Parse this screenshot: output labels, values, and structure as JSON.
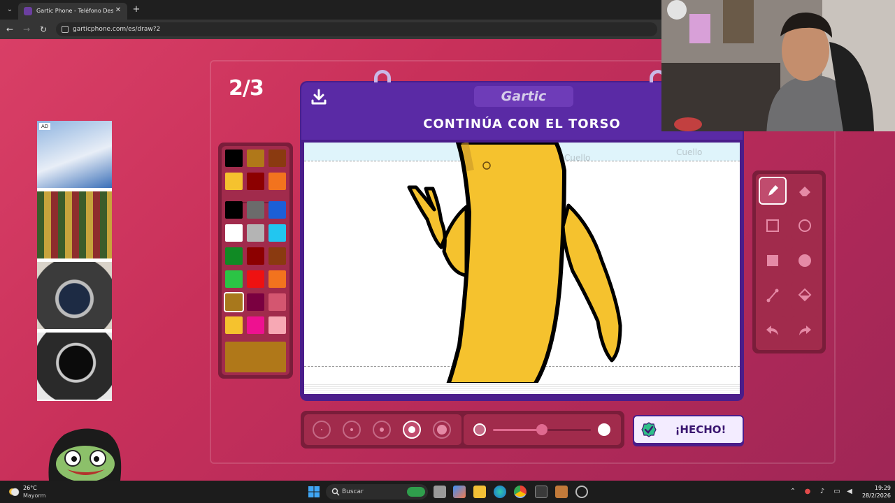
{
  "browser": {
    "tab_title": "Gartic Phone - Teléfono Descon",
    "url": "garticphone.com/es/draw?2"
  },
  "game": {
    "round": "2/3",
    "logo": "Gartic",
    "prompt": "CONTINÚA CON EL TORSO",
    "done_label": "¡HECHO!",
    "canvas_notes": [
      "Cuello",
      "Cuello"
    ]
  },
  "palette": {
    "colors": [
      "#000000",
      "#b07819",
      "#8a3a10",
      "#f5c22e",
      "#8c0000",
      "#f2731e",
      "#000000",
      "#6b6b6b",
      "#1b5fd6",
      "#ffffff",
      "#b4b4b4",
      "#22c6f0",
      "#108a24",
      "#8c0000",
      "#8a3a10",
      "#2bc445",
      "#ee1111",
      "#f2731e",
      "#a8781c",
      "#7a0040",
      "#d45670",
      "#f5c22e",
      "#ee1190",
      "#f7a8b4"
    ],
    "selected_index": 18,
    "current_color": "#b07819"
  },
  "tools": [
    "pen-icon",
    "eraser-icon",
    "rectangle-outline-icon",
    "circle-outline-icon",
    "rectangle-fill-icon",
    "circle-fill-icon",
    "line-icon",
    "fill-bucket-icon",
    "undo-icon",
    "redo-icon"
  ],
  "brush": {
    "sizes_selected_index": 3,
    "opacity": 0.5
  },
  "taskbar": {
    "temperature": "26°C",
    "weather": "Mayorm",
    "search_placeholder": "Buscar",
    "time": "19:29",
    "date": "28/2/2026"
  },
  "colors": {
    "page_bg": "#c8305a",
    "board_purple": "#5a2aa5",
    "accent_yellow": "#f5c22e"
  }
}
